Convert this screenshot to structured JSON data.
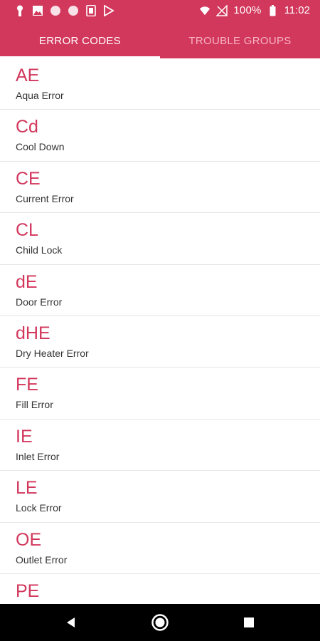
{
  "status_bar": {
    "battery_percent": "100%",
    "time": "11:02",
    "icons": [
      "key-icon",
      "image-icon",
      "circle-icon",
      "circle-icon",
      "sim-icon",
      "play-store-icon"
    ]
  },
  "tabs": [
    {
      "label": "ERROR CODES",
      "active": true
    },
    {
      "label": "TROUBLE GROUPS",
      "active": false
    }
  ],
  "items": [
    {
      "code": "AE",
      "description": "Aqua Error"
    },
    {
      "code": "Cd",
      "description": "Cool Down"
    },
    {
      "code": "CE",
      "description": "Current Error"
    },
    {
      "code": "CL",
      "description": "Child Lock"
    },
    {
      "code": "dE",
      "description": "Door Error"
    },
    {
      "code": "dHE",
      "description": "Dry Heater Error"
    },
    {
      "code": "FE",
      "description": "Fill Error"
    },
    {
      "code": "IE",
      "description": "Inlet Error"
    },
    {
      "code": "LE",
      "description": "Lock Error"
    },
    {
      "code": "OE",
      "description": "Outlet Error"
    },
    {
      "code": "PE",
      "description": ""
    }
  ],
  "colors": {
    "accent": "#d2375c",
    "inactive_tab_text": "#f7b4c3",
    "description_text": "#333333",
    "divider": "#e6e6e6"
  },
  "nav": {
    "icons": [
      "back-icon",
      "home-icon",
      "recents-icon"
    ]
  }
}
